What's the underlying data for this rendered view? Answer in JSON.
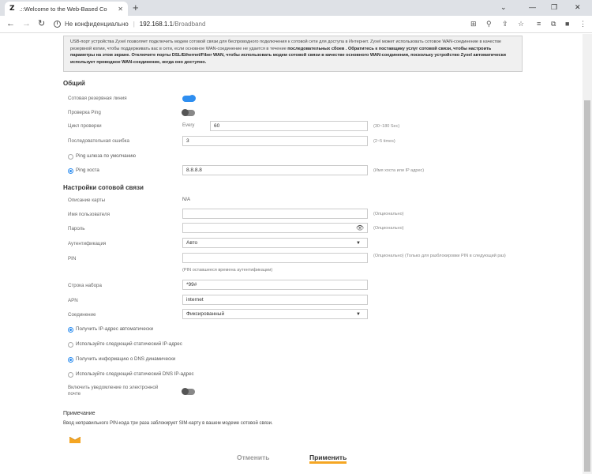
{
  "browser": {
    "tab_logo": "Z",
    "tab_title": ".::Welcome to the Web-Based Co",
    "tab_close": "✕",
    "new_tab": "+",
    "win_down": "⌄",
    "win_min": "—",
    "win_max": "❐",
    "win_close": "✕",
    "back": "←",
    "forward": "→",
    "reload": "↻",
    "security_warning": "i",
    "security_text": "Не конфиденциально",
    "separator": "|",
    "url_host": "192.168.1.1",
    "url_path": "/Broadband",
    "toolbar_icons": [
      "translate-icon",
      "zoom-icon",
      "share-icon",
      "star-icon",
      "reading-list-icon",
      "extensions-icon",
      "profile-icon",
      "menu-icon"
    ],
    "toolbar_glyphs": [
      "⊞",
      "⚲",
      "⇪",
      "☆",
      "≡",
      "⧉",
      "■",
      "⋮"
    ]
  },
  "notice": {
    "text_1": "USB-порт устройства Zyxel позволяет подключить модем сотовой связи для беспроводного подключения к сотовой сети для доступа в Интернет. Zyxel может использовать сотовое WAN-соединение в качестве резервной копии, чтобы поддерживать вас в сети, если основное WAN-соединение не удается в течение ",
    "bold_1": "последовательных сбоев . Обратитесь к поставщику услуг сотовой связи, чтобы настроить параметры на этом экране. Отключите порты DSL/Ethernet/Fiber WAN, чтобы использовать модем сотовой связи в качестве основного WAN-соединения, поскольку устройство Zyxel автоматически использует проводное WAN-соединение, когда оно доступно."
  },
  "general": {
    "title": "Общий",
    "backup_line_label": "Сотовая резервная линия",
    "ping_check_label": "Проверка Ping",
    "check_cycle_label": "Цикл проверки",
    "every_label": "Every",
    "check_cycle_value": "60",
    "check_cycle_hint": "(30~180 Sec)",
    "consecutive_fail_label": "Последовательная ошибка",
    "consecutive_fail_value": "3",
    "consecutive_fail_hint": "(2~5 times)",
    "ping_gateway_label": "Ping шлюза по умолчанию",
    "ping_host_label": "Ping хоста",
    "ping_host_value": "8.8.8.8",
    "ping_host_hint": "(Имя хоста или IP адрес)"
  },
  "cellular": {
    "title": "Настройки сотовой связи",
    "card_desc_label": "Описание карты",
    "card_desc_value": "N/A",
    "username_label": "Имя пользователя",
    "username_hint": "(Опционально)",
    "password_label": "Пароль",
    "password_hint": "(Опционально)",
    "auth_label": "Аутентификация",
    "auth_value": "Авто",
    "pin_label": "PIN",
    "pin_hint": "(Опционально) (Только для разблокировки PIN в следующий раз)",
    "pin_remaining": "(PIN оставшееся времена аутентификации)",
    "dial_label": "Строка набора",
    "dial_value": "*99#",
    "apn_label": "APN",
    "apn_value": "internet",
    "connection_label": "Соединение",
    "connection_value": "Фиксированный",
    "ip_auto_label": "Получить IP-адрес автоматически",
    "ip_static_label": "Используйте следующий статический IP-адрес",
    "dns_auto_label": "Получить информацию о DNS динамически",
    "dns_static_label": "Используйте следующий статический DNS IP-адрес",
    "email_notify_label_1": "Включить уведомление по электронной",
    "email_notify_label_2": "почте"
  },
  "note": {
    "title": "Примечание",
    "text": "Ввод неправильного PIN-кода три раза заблокирует SIM-карту в вашем модеме сотовой связи."
  },
  "buttons": {
    "cancel": "Отменить",
    "apply": "Применить"
  },
  "colors": {
    "accent": "#2e8ef0",
    "apply_underline": "#f5a623"
  }
}
